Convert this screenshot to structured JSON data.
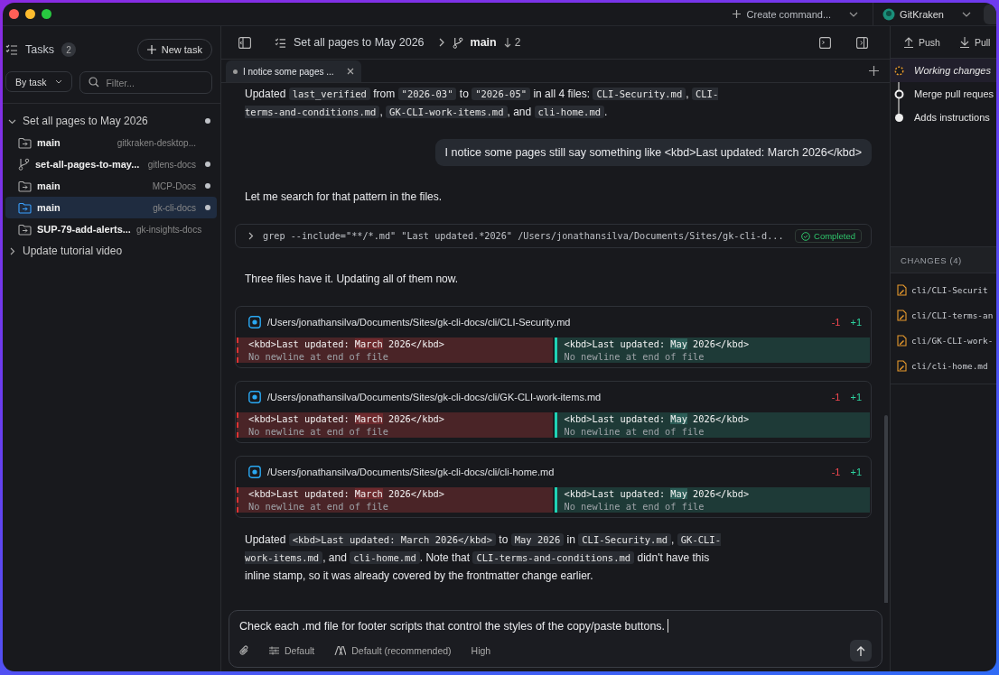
{
  "titlebar": {
    "create_command": "Create command...",
    "account": "GitKraken"
  },
  "sidebar": {
    "title": "Tasks",
    "count": "2",
    "new_task": "New task",
    "group_by": "By task",
    "filter_placeholder": "Filter...",
    "tasks": [
      {
        "label": "Set all pages to May 2026",
        "expanded": true,
        "dot": true,
        "children": [
          {
            "kind": "folder",
            "branch": "main",
            "repo": "gitkraken-desktop...",
            "selected": false,
            "dot": false
          },
          {
            "kind": "branch",
            "branch": "set-all-pages-to-may...",
            "repo": "gitlens-docs",
            "selected": false,
            "dot": true
          },
          {
            "kind": "folder",
            "branch": "main",
            "repo": "MCP-Docs",
            "selected": false,
            "dot": true
          },
          {
            "kind": "folder",
            "branch": "main",
            "repo": "gk-cli-docs",
            "selected": true,
            "dot": true
          },
          {
            "kind": "folder",
            "branch": "SUP-79-add-alerts...",
            "repo": "gk-insights-docs",
            "selected": false,
            "dot": false
          }
        ]
      },
      {
        "label": "Update tutorial video",
        "expanded": false,
        "dot": false
      }
    ]
  },
  "header": {
    "task_title": "Set all pages to May 2026",
    "branch": "main",
    "behind": "2"
  },
  "tabs": [
    {
      "label": "I notice some pages ...",
      "selected": true
    }
  ],
  "messages": [
    {
      "kind": "assistant",
      "parts": [
        {
          "text": "Updated ",
          "code": false
        },
        {
          "text": "last_verified",
          "code": true
        },
        {
          "text": " from ",
          "code": false
        },
        {
          "text": "\"2026-03\"",
          "code": true
        },
        {
          "text": " to ",
          "code": false
        },
        {
          "text": "\"2026-05\"",
          "code": true
        },
        {
          "text": " in all 4 files: ",
          "code": false
        },
        {
          "text": "CLI-Security.md",
          "code": true
        },
        {
          "text": ", ",
          "code": false
        },
        {
          "text": "CLI-terms-and-conditions.md",
          "code": true
        },
        {
          "text": ", ",
          "code": false
        },
        {
          "text": "GK-CLI-work-items.md",
          "code": true
        },
        {
          "text": ", and ",
          "code": false
        },
        {
          "text": "cli-home.md",
          "code": true
        },
        {
          "text": ".",
          "code": false
        }
      ]
    },
    {
      "kind": "user",
      "text": "I notice some pages still say something like <kbd>Last updated: March 2026</kbd>"
    },
    {
      "kind": "assistant",
      "parts": [
        {
          "text": "Let me search for that pattern in the files.",
          "code": false
        }
      ]
    },
    {
      "kind": "tool",
      "command": "grep --include=\"**/*.md\" \"Last updated.*2026\" /Users/jonathansilva/Documents/Sites/gk-cli-d...",
      "status": "Completed"
    },
    {
      "kind": "assistant",
      "parts": [
        {
          "text": "Three files have it. Updating all of them now.",
          "code": false
        }
      ]
    },
    {
      "kind": "diff",
      "path": "/Users/jonathansilva/Documents/Sites/gk-cli-docs/cli/CLI-Security.md",
      "removed": "-1",
      "added": "+1",
      "old": [
        {
          "text": "<kbd>Last updated: ",
          "changed": false
        },
        {
          "text": "March",
          "changed": true
        },
        {
          "text": " 2026</kbd>",
          "changed": false
        }
      ],
      "new": [
        {
          "text": "<kbd>Last updated: ",
          "changed": false
        },
        {
          "text": "May",
          "changed": true
        },
        {
          "text": " 2026</kbd>",
          "changed": false
        }
      ],
      "old_note": "No newline at end of file",
      "new_note": "No newline at end of file"
    },
    {
      "kind": "diff",
      "path": "/Users/jonathansilva/Documents/Sites/gk-cli-docs/cli/GK-CLI-work-items.md",
      "removed": "-1",
      "added": "+1",
      "old": [
        {
          "text": "<kbd>Last updated: ",
          "changed": false
        },
        {
          "text": "March",
          "changed": true
        },
        {
          "text": " 2026</kbd>",
          "changed": false
        }
      ],
      "new": [
        {
          "text": "<kbd>Last updated: ",
          "changed": false
        },
        {
          "text": "May",
          "changed": true
        },
        {
          "text": " 2026</kbd>",
          "changed": false
        }
      ],
      "old_note": "No newline at end of file",
      "new_note": "No newline at end of file"
    },
    {
      "kind": "diff",
      "path": "/Users/jonathansilva/Documents/Sites/gk-cli-docs/cli/cli-home.md",
      "removed": "-1",
      "added": "+1",
      "old": [
        {
          "text": "<kbd>Last updated: ",
          "changed": false
        },
        {
          "text": "March",
          "changed": true
        },
        {
          "text": " 2026</kbd>",
          "changed": false
        }
      ],
      "new": [
        {
          "text": "<kbd>Last updated: ",
          "changed": false
        },
        {
          "text": "May",
          "changed": true
        },
        {
          "text": " 2026</kbd>",
          "changed": false
        }
      ],
      "old_note": "No newline at end of file",
      "new_note": "No newline at end of file"
    },
    {
      "kind": "assistant",
      "parts": [
        {
          "text": "Updated ",
          "code": false
        },
        {
          "text": "<kbd>Last updated: March 2026</kbd>",
          "code": true
        },
        {
          "text": " to ",
          "code": false
        },
        {
          "text": "May 2026",
          "code": true
        },
        {
          "text": " in ",
          "code": false
        },
        {
          "text": "CLI-Security.md",
          "code": true
        },
        {
          "text": ", ",
          "code": false
        },
        {
          "text": "GK-CLI-work-items.md",
          "code": true
        },
        {
          "text": ", and ",
          "code": false
        },
        {
          "text": "cli-home.md",
          "code": true
        },
        {
          "text": ". Note that ",
          "code": false
        },
        {
          "text": "CLI-terms-and-conditions.md",
          "code": true
        },
        {
          "text": " didn't have this inline stamp, so it was already covered by the frontmatter change earlier.",
          "code": false
        }
      ]
    }
  ],
  "composer": {
    "value": "Check each .md file for footer scripts that control the styles of the copy/paste buttons.",
    "mode": "Default",
    "model": "Default (recommended)",
    "effort": "High"
  },
  "right_panel": {
    "actions": [
      "Push",
      "Pull"
    ],
    "commits": [
      {
        "kind": "working",
        "label": "Working changes",
        "selected": true
      },
      {
        "kind": "merge",
        "label": "Merge pull reques",
        "selected": false
      },
      {
        "kind": "commit",
        "label": "Adds instructions",
        "selected": false
      }
    ],
    "changes_title": "CHANGES (4)",
    "files": [
      "cli/CLI-Securit",
      "cli/CLI-terms-an",
      "cli/GK-CLI-work-",
      "cli/cli-home.md"
    ]
  }
}
